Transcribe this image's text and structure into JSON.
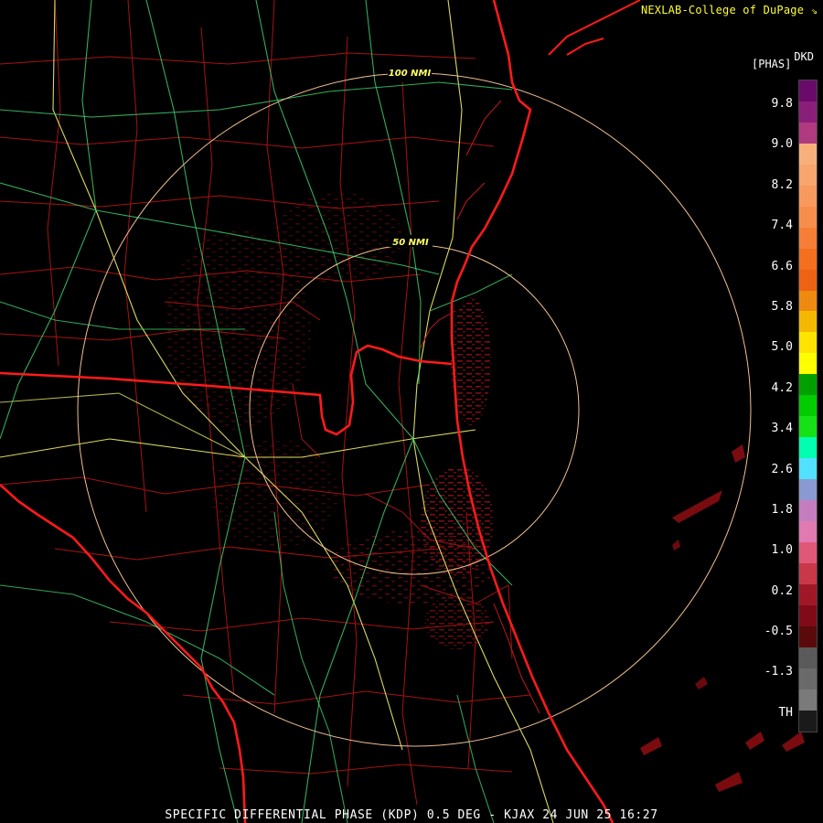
{
  "header": {
    "credit": "NEXLAB-College of DuPage",
    "credit_icon": "corner-arrow-icon"
  },
  "colorbar": {
    "product_code": "DKD",
    "unit": "[PHAS]",
    "labels": [
      "9.8",
      "9.0",
      "8.2",
      "7.4",
      "6.6",
      "5.8",
      "5.0",
      "4.2",
      "3.4",
      "2.6",
      "1.8",
      "1.0",
      "0.2",
      "-0.5",
      "-1.3",
      "TH"
    ],
    "colors": [
      "#6a0a6a",
      "#8a1f7a",
      "#b03a80",
      "#f7b07c",
      "#f8a56e",
      "#f89a5e",
      "#f88e4c",
      "#f77e36",
      "#f46f1e",
      "#ee6214",
      "#ef8a10",
      "#f5b800",
      "#ffe400",
      "#ffff00",
      "#00a000",
      "#00cc00",
      "#16e016",
      "#00ffb0",
      "#52e0ff",
      "#8a9ad0",
      "#c47ec0",
      "#e07ab0",
      "#e05878",
      "#c83848",
      "#a01828",
      "#800a18",
      "#5a0a0a",
      "#5a5a5a",
      "#6a6a6a",
      "#7a7a7a",
      "#1a1a1a"
    ]
  },
  "map": {
    "range_rings": [
      "50 NMI",
      "100 NMI"
    ],
    "colors": {
      "coast": "#ff1a1a",
      "county": "#c01818",
      "highway_green": "#40d870",
      "highway_yellow": "#ffff70",
      "ring": "#f0c090",
      "echo": "#7a0c10"
    }
  },
  "footer": {
    "title": "SPECIFIC DIFFERENTIAL PHASE (KDP) 0.5 DEG - KJAX 24 JUN 25 16:27"
  }
}
